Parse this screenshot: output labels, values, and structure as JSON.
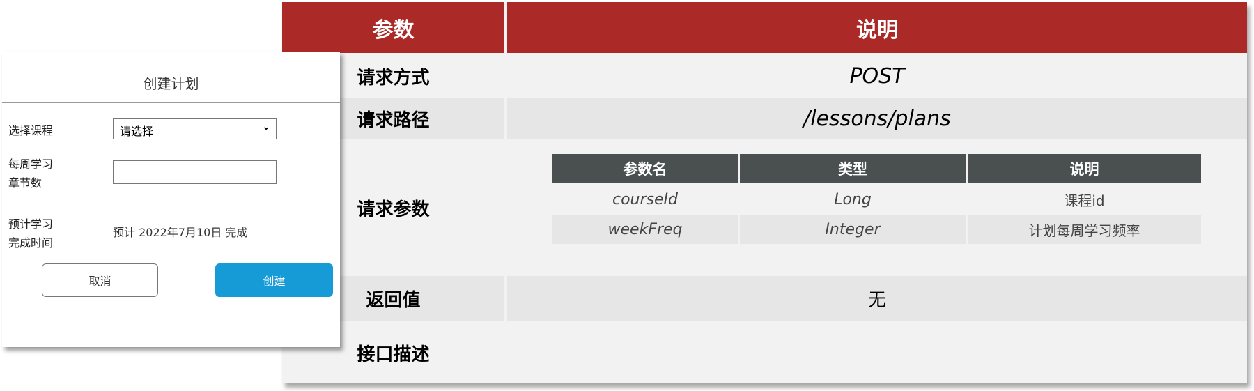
{
  "api_table": {
    "headers": [
      "参数",
      "说明"
    ],
    "rows": [
      {
        "label": "请求方式",
        "value": "POST"
      },
      {
        "label": "请求路径",
        "value": "/lessons/plans"
      },
      {
        "label": "请求参数",
        "value": ""
      },
      {
        "label": "返回值",
        "value": "无"
      },
      {
        "label": "接口描述",
        "value": ""
      }
    ],
    "params": {
      "headers": [
        "参数名",
        "类型",
        "说明"
      ],
      "rows": [
        [
          "courseId",
          "Long",
          "课程id"
        ],
        [
          "weekFreq",
          "Integer",
          "计划每周学习频率"
        ]
      ]
    },
    "colors": {
      "header": "#ab2a27",
      "sub_header": "#4a5050"
    }
  },
  "dialog": {
    "title": "创建计划",
    "course_label": "选择课程",
    "course_select": "请选择",
    "weekly_label_1": "每周学习",
    "weekly_label_2": "章节数",
    "weekly_value": "",
    "finish_label_1": "预计学习",
    "finish_label_2": "完成时间",
    "finish_value": "预计 2022年7月10日 完成",
    "cancel": "取消",
    "create": "创建",
    "accent": "#179bd7"
  }
}
